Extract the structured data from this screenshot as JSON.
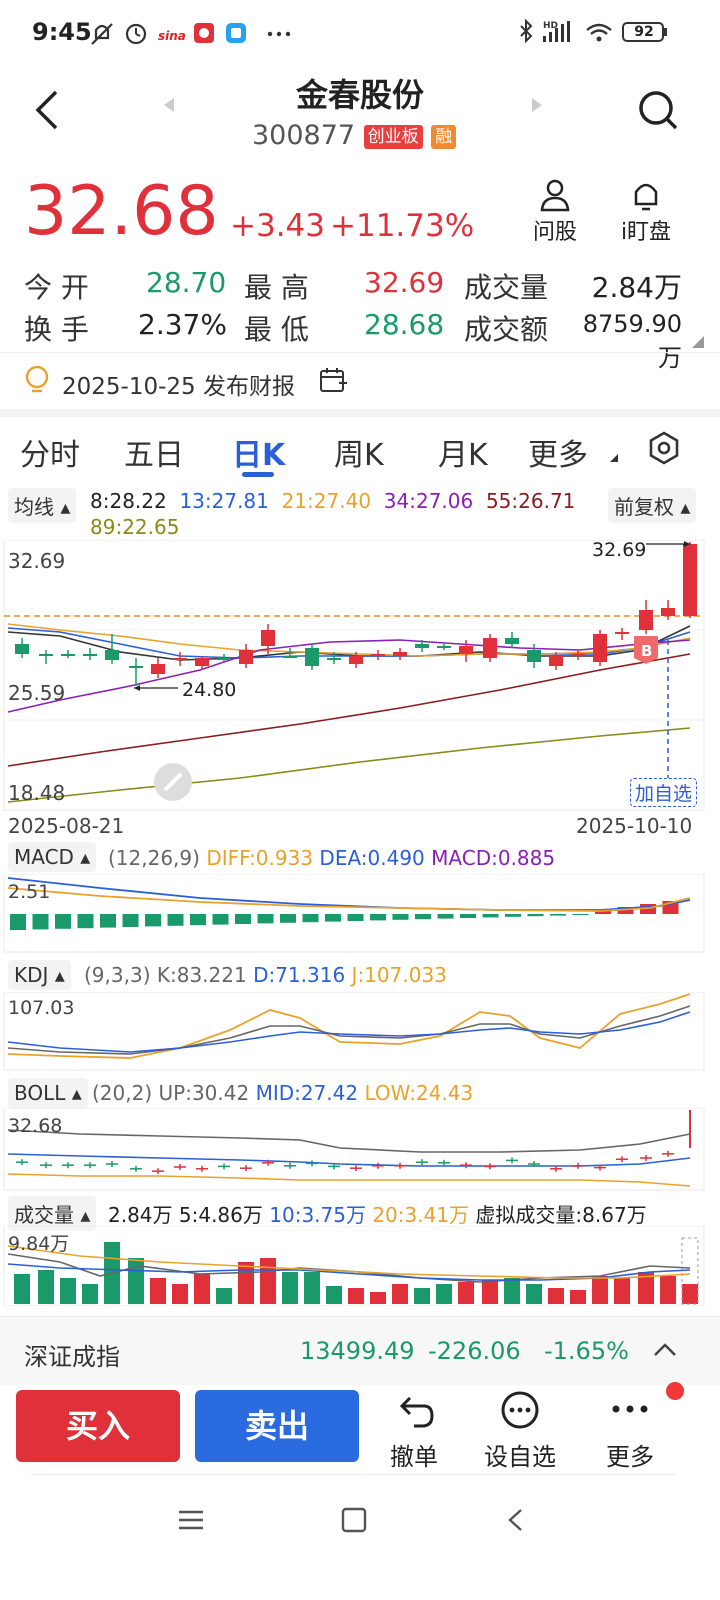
{
  "status_bar": {
    "time": "9:45",
    "battery": "92"
  },
  "header": {
    "title": "金春股份",
    "code": "300877",
    "board_tag": "创业板",
    "margin_tag": "融"
  },
  "quote": {
    "price": "32.68",
    "change": "+3.43",
    "change_pct": "+11.73%"
  },
  "actions": {
    "ask_label": "问股",
    "watch_label": "i盯盘"
  },
  "stats": {
    "open_label": "今 开",
    "open": "28.70",
    "high_label": "最 高",
    "high": "32.69",
    "volume_label": "成交量",
    "volume": "2.84万",
    "turnover_label": "换 手",
    "turnover": "2.37%",
    "low_label": "最 低",
    "low": "28.68",
    "amount_label": "成交额",
    "amount": "8759.90万"
  },
  "notice": {
    "text": "2025-10-25 发布财报"
  },
  "tabs": [
    "分时",
    "五日",
    "日K",
    "周K",
    "月K",
    "更多"
  ],
  "ma": {
    "label": "均线",
    "ma8": "8:28.22",
    "ma13": "13:27.81",
    "ma21": "21:27.40",
    "ma34": "34:27.06",
    "ma55": "55:26.71",
    "ma89": "89:22.65",
    "adjust": "前复权"
  },
  "kline": {
    "y_top": "32.69",
    "y_mid": "25.59",
    "y_bot": "18.48",
    "low_mark": "24.80",
    "high_mark": "32.69",
    "date_start": "2025-08-21",
    "date_end": "2025-10-10",
    "add_watch": "加自选",
    "badge": "B"
  },
  "macd": {
    "label": "MACD",
    "params": "(12,26,9)",
    "diff": "DIFF:0.933",
    "dea": "DEA:0.490",
    "macd": "MACD:0.885",
    "y_top": "2.51"
  },
  "kdj": {
    "label": "KDJ",
    "params": "(9,3,3)",
    "k": "K:83.221",
    "d": "D:71.316",
    "j": "J:107.033",
    "y_top": "107.03"
  },
  "boll": {
    "label": "BOLL",
    "params": "(20,2)",
    "up": "UP:30.42",
    "mid": "MID:27.42",
    "low": "LOW:24.43",
    "y_top": "32.68"
  },
  "vol": {
    "label": "成交量",
    "v": "2.84万",
    "v5": "5:4.86万",
    "v10": "10:3.75万",
    "v20": "20:3.41万",
    "virtual": "虚拟成交量:8.67万",
    "y_top": "9.84万"
  },
  "index_bar": {
    "name": "深证成指",
    "value": "13499.49",
    "change": "-226.06",
    "pct": "-1.65%"
  },
  "bottom": {
    "buy": "买入",
    "sell": "卖出",
    "cancel": "撤单",
    "watchlist": "设自选",
    "more": "更多"
  },
  "colors": {
    "up": "#e0303a",
    "down": "#1a9a6a",
    "buy": "#e0303a",
    "sell": "#2a6be0"
  }
}
